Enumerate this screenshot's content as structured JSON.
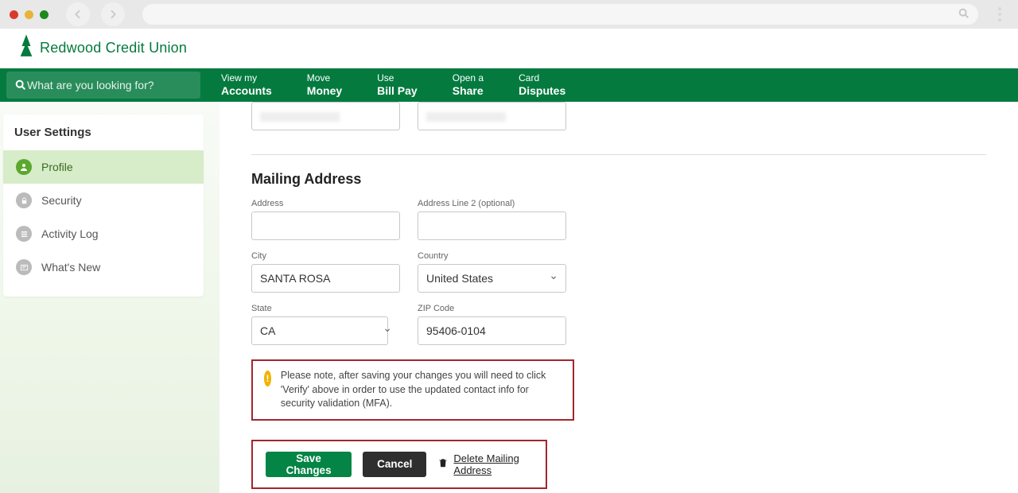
{
  "logo_text": "Redwood Credit Union",
  "search_placeholder": "What are you looking for?",
  "nav": [
    {
      "small": "View my",
      "big": "Accounts"
    },
    {
      "small": "Move",
      "big": "Money"
    },
    {
      "small": "Use",
      "big": "Bill Pay"
    },
    {
      "small": "Open a",
      "big": "Share"
    },
    {
      "small": "Card",
      "big": "Disputes"
    }
  ],
  "sidebar": {
    "title": "User Settings",
    "items": [
      {
        "label": "Profile"
      },
      {
        "label": "Security"
      },
      {
        "label": "Activity Log"
      },
      {
        "label": "What's New"
      }
    ]
  },
  "section_title": "Mailing Address",
  "fields": {
    "address_label": "Address",
    "address2_label": "Address Line 2 (optional)",
    "city_label": "City",
    "city_value": "SANTA ROSA",
    "country_label": "Country",
    "country_value": "United States",
    "state_label": "State",
    "state_value": "CA",
    "zip_label": "ZIP Code",
    "zip_value": "95406-0104"
  },
  "note": "Please note, after saving your changes you will need to click 'Verify' above in order to use the updated contact info for security validation (MFA).",
  "buttons": {
    "save": "Save Changes",
    "cancel": "Cancel",
    "delete": "Delete Mailing Address"
  }
}
